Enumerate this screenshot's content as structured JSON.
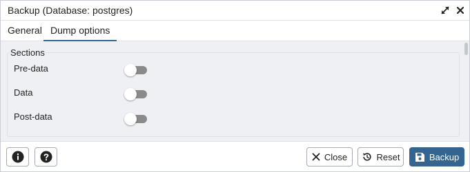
{
  "dialog": {
    "title": "Backup (Database: postgres)",
    "expand_icon": "expand-arrows-icon",
    "close_icon": "close-x-icon"
  },
  "tabs": [
    {
      "label": "General",
      "active": false
    },
    {
      "label": "Dump options",
      "active": true
    }
  ],
  "sections": {
    "legend": "Sections",
    "items": [
      {
        "label": "Pre-data",
        "enabled": false
      },
      {
        "label": "Data",
        "enabled": false
      },
      {
        "label": "Post-data",
        "enabled": false
      }
    ]
  },
  "footer": {
    "info_icon": "info-circle-icon",
    "help_icon": "question-circle-icon",
    "close_label": "Close",
    "reset_label": "Reset",
    "backup_label": "Backup"
  },
  "colors": {
    "accent": "#326690",
    "toggle_off_track": "#8a8a8a",
    "content_bg": "#eef0f4"
  }
}
